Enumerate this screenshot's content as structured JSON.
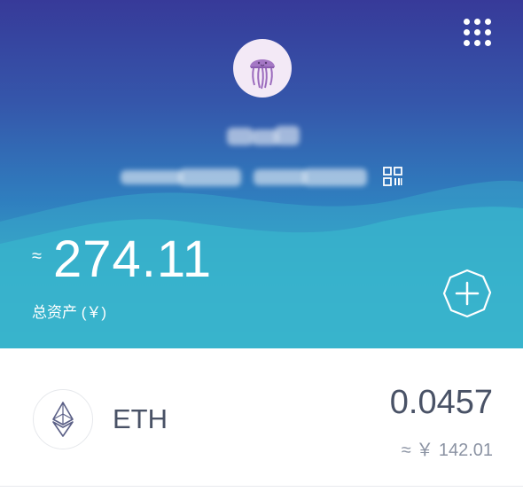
{
  "header": {
    "wallet_name": "█████",
    "wallet_address": "██████████████████████",
    "total_prefix": "≈",
    "total_amount": "274.11",
    "total_label": "总资产 (￥)"
  },
  "assets": [
    {
      "symbol": "ETH",
      "amount": "0.0457",
      "value": "≈ ￥ 142.01"
    }
  ],
  "icons": {
    "menu": "grid-dots-icon",
    "qr": "qr-code-icon",
    "add": "add-asset-icon",
    "avatar": "jellyfish-avatar",
    "eth": "ethereum-logo-icon"
  },
  "colors": {
    "header_top": "#373a99",
    "header_bottom": "#3ab9cb",
    "text_dark": "#495266",
    "text_muted": "#8b93a3",
    "avatar_bg": "#f3e9f6",
    "avatar_jelly": "#9b6bbd"
  }
}
